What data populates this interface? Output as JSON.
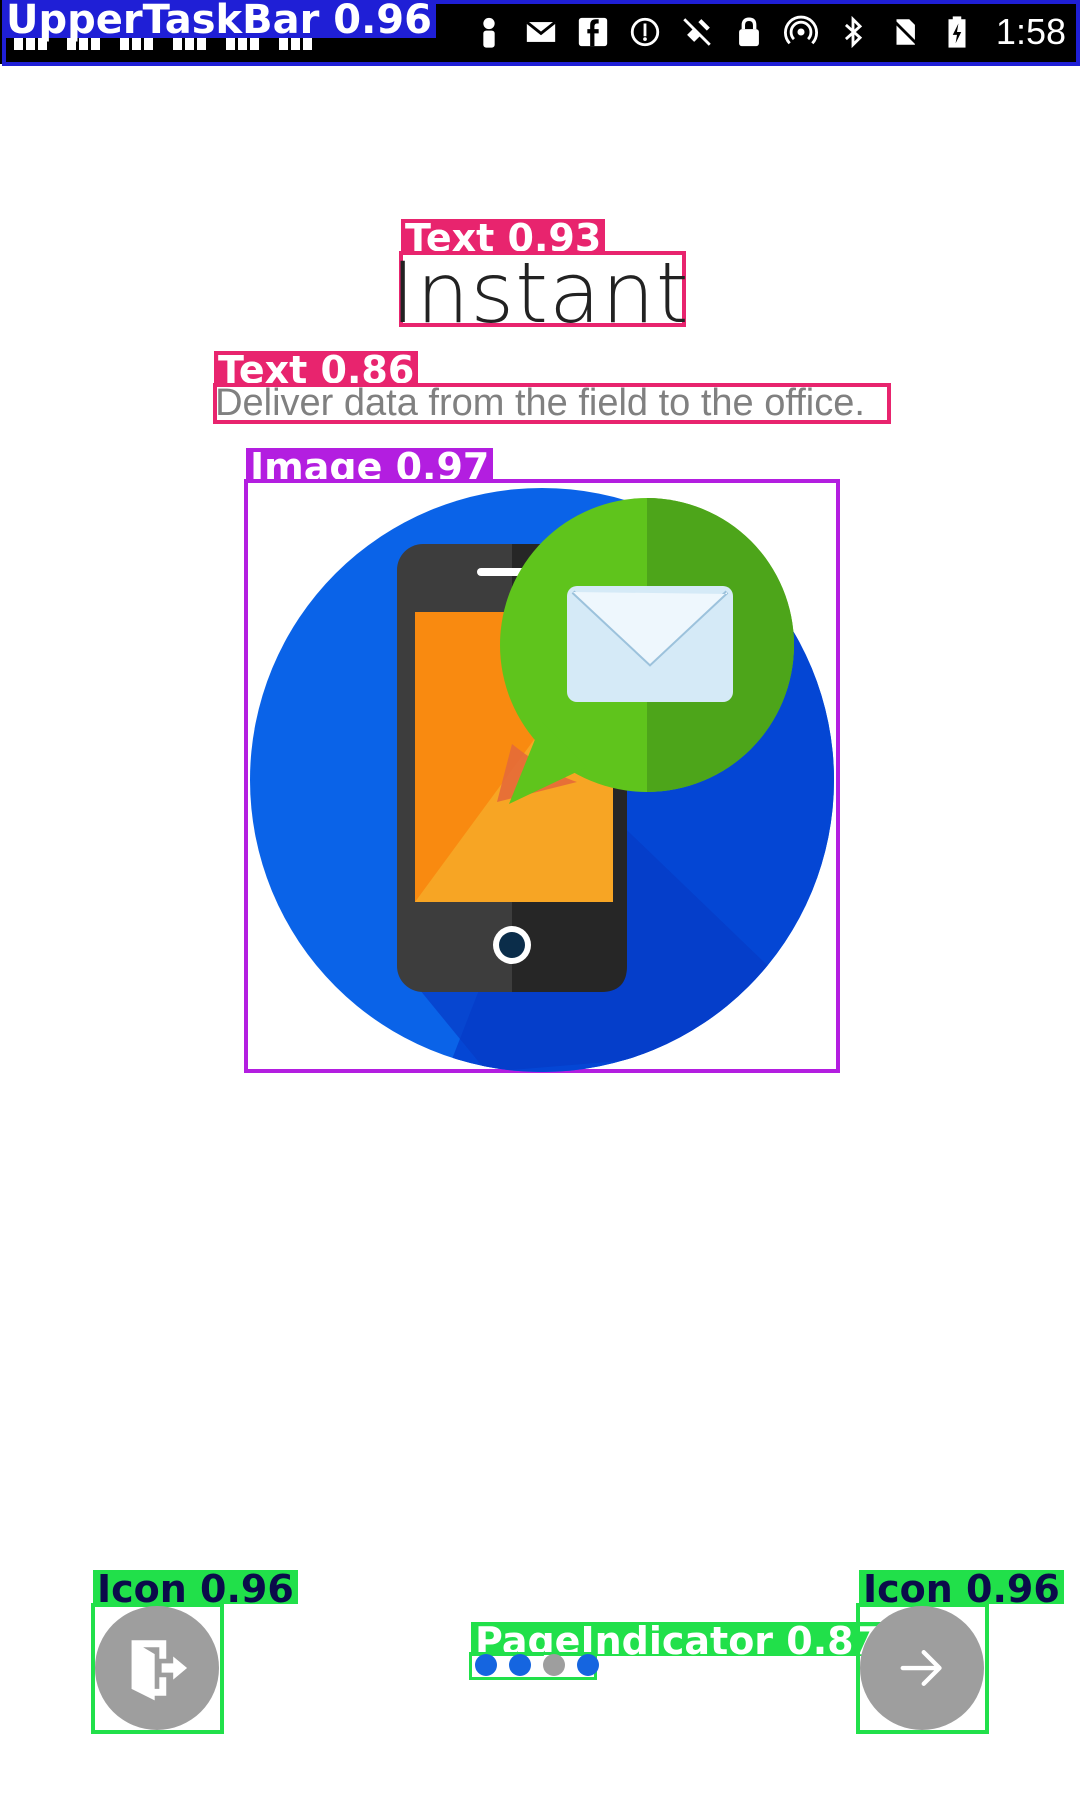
{
  "status_bar": {
    "time": "1:58",
    "icons": [
      "signal-icon",
      "person-icon",
      "mail-icon",
      "facebook-icon",
      "sync-icon",
      "gps-off-icon",
      "lock-icon",
      "hotspot-icon",
      "bluetooth-icon",
      "no-sim-icon",
      "battery-charging-icon"
    ]
  },
  "overlay_labels": {
    "taskbar": "UpperTaskBar 0.96",
    "title_text": "Text 0.93",
    "subtitle_text": "Text 0.86",
    "image": "Image 0.97",
    "icon_left": "Icon 0.96",
    "icon_right": "Icon 0.96",
    "page_indicator": "PageIndicator 0.87"
  },
  "main": {
    "title": "Instant",
    "subtitle": "Deliver data from the field to the office."
  },
  "pager": {
    "total": 4,
    "active": 3,
    "active_color": "#1565e0",
    "inactive_color": "#9e9e9e"
  },
  "colors": {
    "taskbar_box": "#1f1fd6",
    "text_box": "#e8246e",
    "image_box": "#b31ee0",
    "icon_box": "#21e04a",
    "nav_button": "#9e9e9e"
  }
}
